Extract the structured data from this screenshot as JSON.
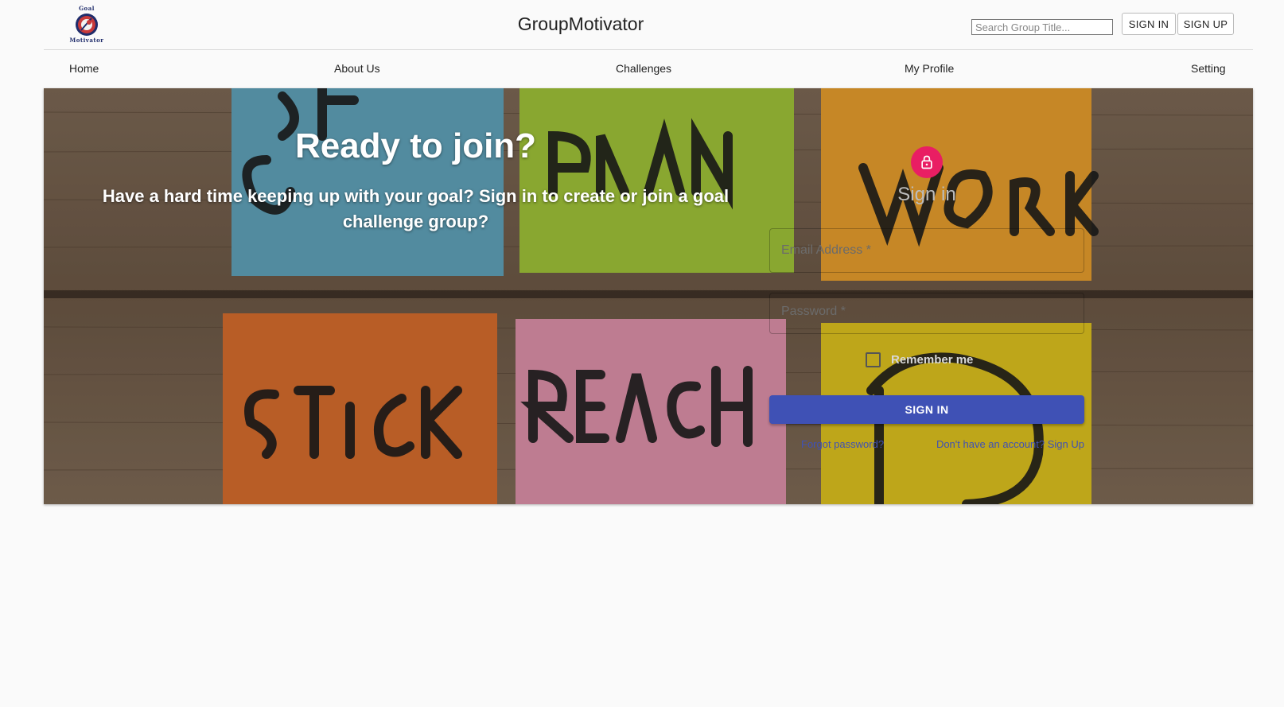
{
  "header": {
    "logo_top": "Goal",
    "logo_bottom": "Motivator",
    "app_title": "GroupMotivator",
    "search_placeholder": "Search Group Title...",
    "signin_button": "SIGN IN",
    "signup_button": "SIGN UP"
  },
  "nav": {
    "items": [
      {
        "label": "Home"
      },
      {
        "label": "About Us"
      },
      {
        "label": "Challenges"
      },
      {
        "label": "My Profile"
      },
      {
        "label": "Setting"
      }
    ]
  },
  "hero": {
    "heading": "Ready to join?",
    "subheading": "Have a hard time keeping up with your goal? Sign in to create or join a goal challenge group?",
    "background_notes": [
      "SET GOAL",
      "MAKE PLAN",
      "GET TO WORK",
      "STICK TO IT",
      "REACH GOAL"
    ]
  },
  "signin": {
    "icon": "lock-icon",
    "title": "Sign in",
    "email_label": "Email Address *",
    "password_label": "Password *",
    "remember_label": "Remember me",
    "submit_label": "SIGN IN",
    "forgot_link": "Forgot password?",
    "signup_link": "Don't have an account? Sign Up"
  },
  "colors": {
    "accent": "#3f51b5",
    "lock_avatar": "#e91e63",
    "page_bg": "#fafafa"
  }
}
